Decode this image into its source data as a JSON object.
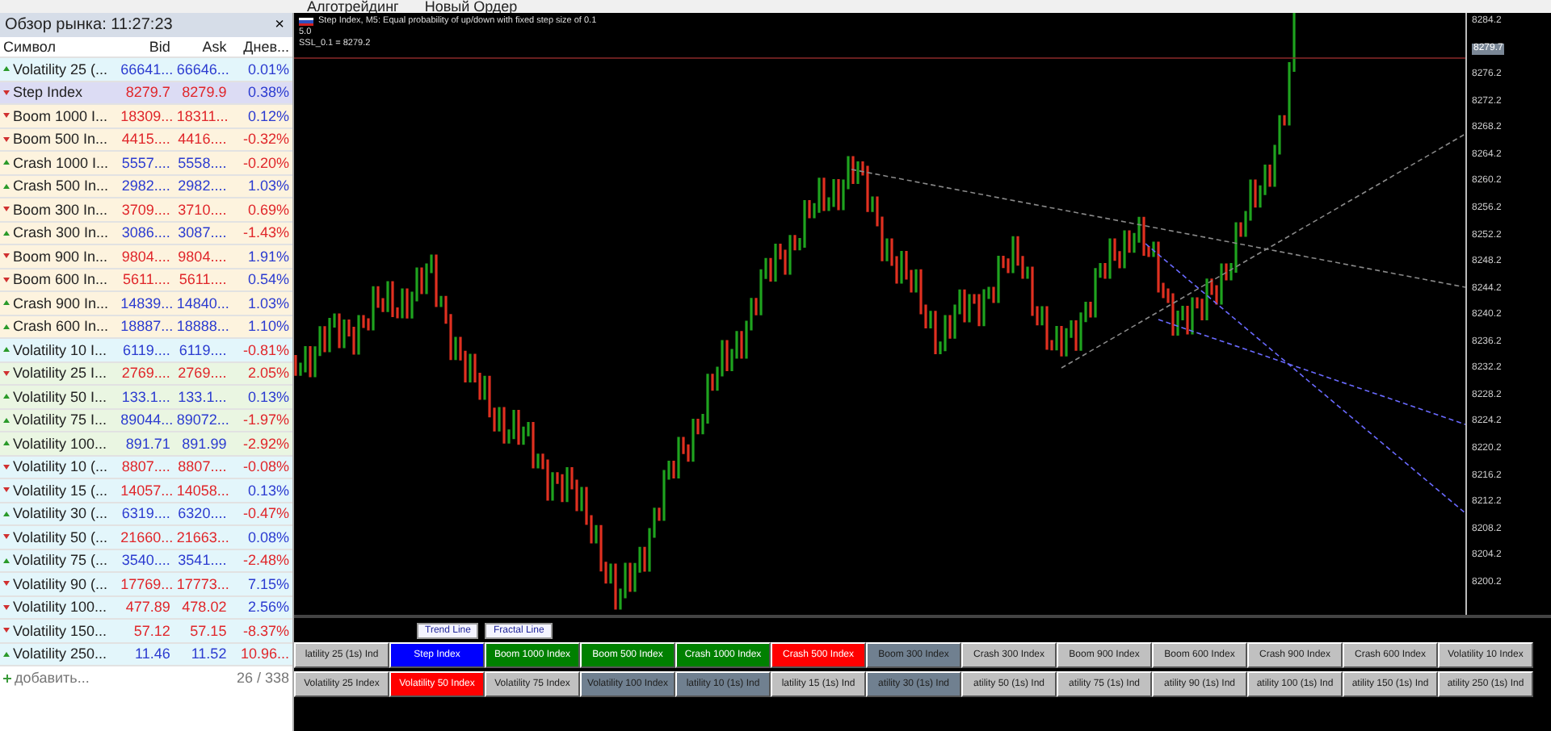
{
  "toolbar": {
    "items": [
      "Алготрейдинг",
      "Новый Ордер"
    ]
  },
  "market_watch": {
    "title": "Обзор рынка: 11:27:23",
    "close": "×",
    "columns": [
      "Символ",
      "Bid",
      "Ask",
      "Днев..."
    ],
    "rows": [
      {
        "symbol": "Volatility 25 (...",
        "bid": "66641...",
        "ask": "66646...",
        "change": "0.01%",
        "rising": true,
        "falling": false,
        "kind": "secondly",
        "selected": false
      },
      {
        "symbol": "Step Index",
        "bid": "8279.7",
        "ask": "8279.9",
        "change": "0.38%",
        "rising": false,
        "falling": false,
        "kind": "step",
        "selected": true
      },
      {
        "symbol": "Boom 1000 I...",
        "bid": "18309...",
        "ask": "18311...",
        "change": "0.12%",
        "rising": false,
        "falling": false,
        "kind": "crashboom",
        "selected": false
      },
      {
        "symbol": "Boom 500 In...",
        "bid": "4415....",
        "ask": "4416....",
        "change": "-0.32%",
        "rising": false,
        "falling": true,
        "kind": "crashboom",
        "selected": false
      },
      {
        "symbol": "Crash 1000 I...",
        "bid": "5557....",
        "ask": "5558....",
        "change": "-0.20%",
        "rising": true,
        "falling": true,
        "kind": "crashboom",
        "selected": false
      },
      {
        "symbol": "Crash 500 In...",
        "bid": "2982....",
        "ask": "2982....",
        "change": "1.03%",
        "rising": true,
        "falling": false,
        "kind": "crashboom",
        "selected": false
      },
      {
        "symbol": "Boom 300 In...",
        "bid": "3709....",
        "ask": "3710....",
        "change": "0.69%",
        "rising": false,
        "falling": true,
        "kind": "crashboom",
        "selected": false
      },
      {
        "symbol": "Crash 300 In...",
        "bid": "3086....",
        "ask": "3087....",
        "change": "-1.43%",
        "rising": true,
        "falling": true,
        "kind": "crashboom",
        "selected": false
      },
      {
        "symbol": "Boom 900 In...",
        "bid": "9804....",
        "ask": "9804....",
        "change": "1.91%",
        "rising": false,
        "falling": false,
        "kind": "crashboom",
        "selected": false
      },
      {
        "symbol": "Boom 600 In...",
        "bid": "5611....",
        "ask": "5611....",
        "change": "0.54%",
        "rising": false,
        "falling": false,
        "kind": "crashboom",
        "selected": false
      },
      {
        "symbol": "Crash 900 In...",
        "bid": "14839...",
        "ask": "14840...",
        "change": "1.03%",
        "rising": true,
        "falling": false,
        "kind": "crashboom",
        "selected": false
      },
      {
        "symbol": "Crash 600 In...",
        "bid": "18887...",
        "ask": "18888...",
        "change": "1.10%",
        "rising": true,
        "falling": false,
        "kind": "crashboom",
        "selected": false
      },
      {
        "symbol": "Volatility 10 I...",
        "bid": "6119....",
        "ask": "6119....",
        "change": "-0.81%",
        "rising": true,
        "falling": true,
        "kind": "secondly",
        "selected": false
      },
      {
        "symbol": "Volatility 25 I...",
        "bid": "2769....",
        "ask": "2769....",
        "change": "2.05%",
        "rising": false,
        "falling": true,
        "kind": "volatility",
        "selected": false
      },
      {
        "symbol": "Volatility 50 I...",
        "bid": "133.1...",
        "ask": "133.1...",
        "change": "0.13%",
        "rising": true,
        "falling": false,
        "kind": "volatility",
        "selected": false
      },
      {
        "symbol": "Volatility 75 I...",
        "bid": "89044...",
        "ask": "89072...",
        "change": "-1.97%",
        "rising": true,
        "falling": true,
        "kind": "volatility",
        "selected": false
      },
      {
        "symbol": "Volatility 100...",
        "bid": "891.71",
        "ask": "891.99",
        "change": "-2.92%",
        "rising": true,
        "falling": true,
        "kind": "volatility",
        "selected": false
      },
      {
        "symbol": "Volatility 10 (...",
        "bid": "8807....",
        "ask": "8807....",
        "change": "-0.08%",
        "rising": false,
        "falling": true,
        "kind": "secondly",
        "selected": false
      },
      {
        "symbol": "Volatility 15 (...",
        "bid": "14057...",
        "ask": "14058...",
        "change": "0.13%",
        "rising": false,
        "falling": false,
        "kind": "secondly",
        "selected": false
      },
      {
        "symbol": "Volatility 30 (...",
        "bid": "6319....",
        "ask": "6320....",
        "change": "-0.47%",
        "rising": true,
        "falling": true,
        "kind": "secondly",
        "selected": false
      },
      {
        "symbol": "Volatility 50 (...",
        "bid": "21660...",
        "ask": "21663...",
        "change": "0.08%",
        "rising": false,
        "falling": false,
        "kind": "secondly",
        "selected": false
      },
      {
        "symbol": "Volatility 75 (...",
        "bid": "3540....",
        "ask": "3541....",
        "change": "-2.48%",
        "rising": true,
        "falling": true,
        "kind": "secondly",
        "selected": false
      },
      {
        "symbol": "Volatility 90 (...",
        "bid": "17769...",
        "ask": "17773...",
        "change": "7.15%",
        "rising": false,
        "falling": false,
        "kind": "secondly",
        "selected": false
      },
      {
        "symbol": "Volatility 100...",
        "bid": "477.89",
        "ask": "478.02",
        "change": "2.56%",
        "rising": false,
        "falling": false,
        "kind": "secondly",
        "selected": false
      },
      {
        "symbol": "Volatility 150...",
        "bid": "57.12",
        "ask": "57.15",
        "change": "-8.37%",
        "rising": false,
        "falling": true,
        "kind": "secondly",
        "selected": false
      },
      {
        "symbol": "Volatility 250...",
        "bid": "11.46",
        "ask": "11.52",
        "change": "10.96...",
        "rising": true,
        "falling": true,
        "kind": "secondly",
        "selected": false
      }
    ],
    "add": "добавить...",
    "count": "26 / 338"
  },
  "chart": {
    "title": "Step Index, M5: Equal probability of up/down with fixed step size of 0.1",
    "lines": [
      "5.0",
      "SSL_0.1 = 8279.2"
    ],
    "price_axis": [
      "8284.2",
      "8276.2",
      "8272.2",
      "8268.2",
      "8264.2",
      "8260.2",
      "8256.2",
      "8252.2",
      "8248.2",
      "8244.2",
      "8240.2",
      "8236.2",
      "8232.2",
      "8228.2",
      "8224.2",
      "8220.2",
      "8216.2",
      "8212.2",
      "8208.2",
      "8204.2",
      "8200.2"
    ],
    "current_price": "8279.7"
  },
  "tools": [
    "Trend Line",
    "Fractal Line"
  ],
  "symbol_buttons": [
    [
      {
        "label": "latility 25 (1s) Ind",
        "color": "#c0c0c0"
      },
      {
        "label": "Step Index",
        "color": "#0000ff"
      },
      {
        "label": "Boom 1000 Index",
        "color": "#008000"
      },
      {
        "label": "Boom 500 Index",
        "color": "#008000"
      },
      {
        "label": "Crash 1000 Index",
        "color": "#008000"
      },
      {
        "label": "Crash 500 Index",
        "color": "#ff0000"
      },
      {
        "label": "Boom 300 Index",
        "color": "#708090"
      },
      {
        "label": "Crash 300 Index",
        "color": "#c0c0c0"
      },
      {
        "label": "Boom 900 Index",
        "color": "#c0c0c0"
      },
      {
        "label": "Boom 600 Index",
        "color": "#c0c0c0"
      },
      {
        "label": "Crash 900 Index",
        "color": "#c0c0c0"
      },
      {
        "label": "Crash 600 Index",
        "color": "#c0c0c0"
      },
      {
        "label": "Volatility 10 Index",
        "color": "#c0c0c0"
      }
    ],
    [
      {
        "label": "Volatility 25 Index",
        "color": "#c0c0c0"
      },
      {
        "label": "Volatility 50 Index",
        "color": "#ff0000"
      },
      {
        "label": "Volatility 75 Index",
        "color": "#c0c0c0"
      },
      {
        "label": "Volatility 100 Index",
        "color": "#708090"
      },
      {
        "label": "latility 10 (1s) Ind",
        "color": "#708090"
      },
      {
        "label": "latility 15 (1s) Ind",
        "color": "#c0c0c0"
      },
      {
        "label": "atility 30 (1s) Ind",
        "color": "#708090"
      },
      {
        "label": "atility 50 (1s) Ind",
        "color": "#c0c0c0"
      },
      {
        "label": "atility 75 (1s) Ind",
        "color": "#c0c0c0"
      },
      {
        "label": "atility 90 (1s) Ind",
        "color": "#c0c0c0"
      },
      {
        "label": "atility 100 (1s) Ind",
        "color": "#c0c0c0"
      },
      {
        "label": "atility 150 (1s) Ind",
        "color": "#c0c0c0"
      },
      {
        "label": "atility 250 (1s) Ind",
        "color": "#c0c0c0"
      }
    ]
  ]
}
